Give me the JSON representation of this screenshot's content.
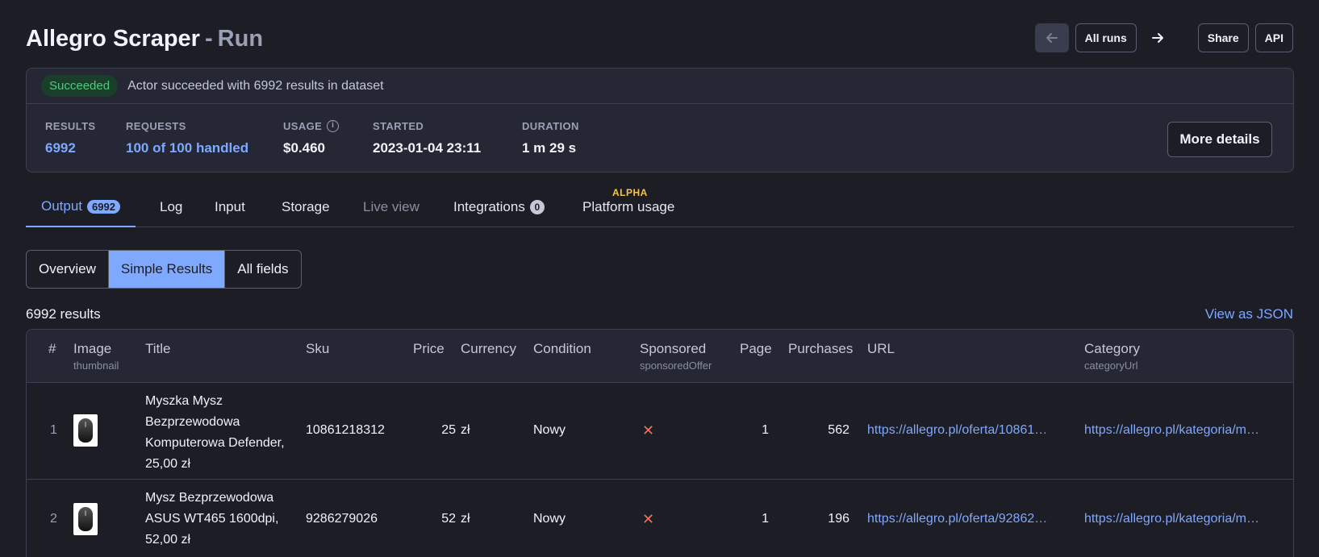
{
  "header": {
    "title": "Allegro Scraper",
    "separator": "-",
    "subtitle": "Run",
    "all_runs_label": "All runs",
    "share_label": "Share",
    "api_label": "API"
  },
  "status": {
    "badge": "Succeeded",
    "message": "Actor succeeded with 6992 results in dataset",
    "more_details_label": "More details",
    "stats": [
      {
        "label": "RESULTS",
        "value": "6992"
      },
      {
        "label": "REQUESTS",
        "value": "100 of 100 handled"
      },
      {
        "label": "USAGE",
        "value": "$0.460"
      },
      {
        "label": "STARTED",
        "value": "2023-01-04 23:11"
      },
      {
        "label": "DURATION",
        "value": "1 m 29 s"
      }
    ]
  },
  "tabs": [
    {
      "label": "Output",
      "count": "6992"
    },
    {
      "label": "Log"
    },
    {
      "label": "Input"
    },
    {
      "label": "Storage"
    },
    {
      "label": "Live view"
    },
    {
      "label": "Integrations",
      "count": "0"
    },
    {
      "label": "Platform usage",
      "tag": "ALPHA"
    }
  ],
  "views": [
    "Overview",
    "Simple Results",
    "All fields"
  ],
  "results_count": "6992 results",
  "view_json_label": "View as JSON",
  "table": {
    "columns": [
      {
        "label": "#"
      },
      {
        "label": "Image",
        "sub": "thumbnail"
      },
      {
        "label": "Title"
      },
      {
        "label": "Sku"
      },
      {
        "label": "Price"
      },
      {
        "label": "Currency"
      },
      {
        "label": "Condition"
      },
      {
        "label": "Sponsored",
        "sub": "sponsoredOffer"
      },
      {
        "label": "Page"
      },
      {
        "label": "Purchases"
      },
      {
        "label": "URL"
      },
      {
        "label": "Category",
        "sub": "categoryUrl"
      }
    ],
    "rows": [
      {
        "index": "1",
        "title": "Myszka Mysz Bezprzewodowa Komputerowa Defender, 25,00 zł",
        "sku": "10861218312",
        "price": "25",
        "currency": "zł",
        "condition": "Nowy",
        "sponsored": "✕",
        "page": "1",
        "purchases": "562",
        "url": "https://allegro.pl/oferta/10861…",
        "category": "https://allegro.pl/kategoria/m…"
      },
      {
        "index": "2",
        "title": "Mysz Bezprzewodowa ASUS WT465 1600dpi, 52,00 zł",
        "sku": "9286279026",
        "price": "52",
        "currency": "zł",
        "condition": "Nowy",
        "sponsored": "✕",
        "page": "1",
        "purchases": "196",
        "url": "https://allegro.pl/oferta/92862…",
        "category": "https://allegro.pl/kategoria/m…"
      }
    ]
  }
}
